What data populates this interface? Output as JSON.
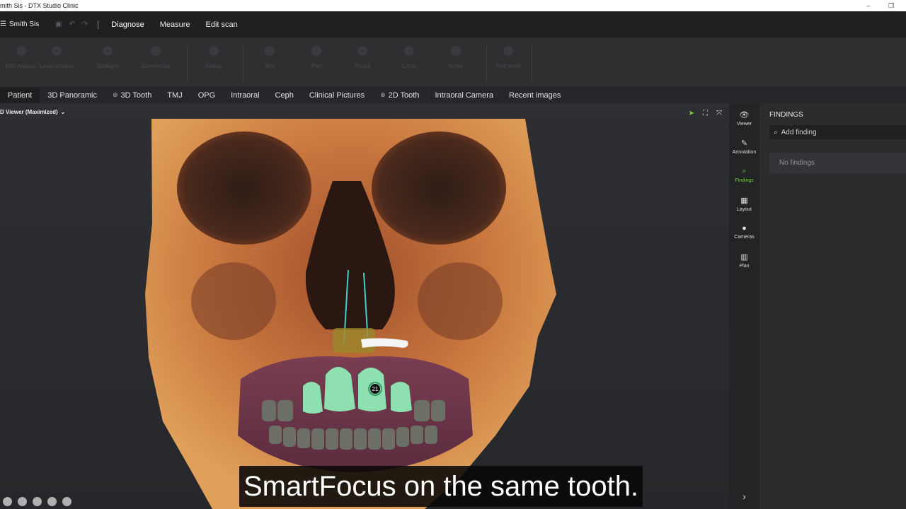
{
  "window": {
    "title": "mith Sis - DTX Studio Clinic",
    "minimize": "–",
    "restore": "❐"
  },
  "menubar": {
    "user": "Smith Sis",
    "menu": [
      "Diagnose",
      "Measure",
      "Edit scan"
    ]
  },
  "ribbon": {
    "items": [
      "Bite Appear.",
      "Level window",
      "Spotlight",
      "Screenshot",
      "Airway",
      "Text",
      "Pen",
      "Pencil",
      "Circle",
      "Arrow",
      "Find teeth"
    ]
  },
  "tabs": [
    {
      "label": "Patient",
      "icon": ""
    },
    {
      "label": "3D Panoramic",
      "icon": ""
    },
    {
      "label": "3D Tooth",
      "icon": "⊕"
    },
    {
      "label": "TMJ",
      "icon": ""
    },
    {
      "label": "OPG",
      "icon": ""
    },
    {
      "label": "Intraoral",
      "icon": ""
    },
    {
      "label": "Ceph",
      "icon": ""
    },
    {
      "label": "Clinical Pictures",
      "icon": ""
    },
    {
      "label": "2D Tooth",
      "icon": "⊕"
    },
    {
      "label": "Intraoral Camera",
      "icon": ""
    },
    {
      "label": "Recent images",
      "icon": ""
    }
  ],
  "viewer": {
    "title": "D Viewer (Maximized)",
    "tooth_number": "21",
    "subtitle": "SmartFocus on the same tooth."
  },
  "rightbar": {
    "items": [
      {
        "label": "Viewer",
        "glyph": "👁"
      },
      {
        "label": "Annotation",
        "glyph": "✎"
      },
      {
        "label": "Findings",
        "glyph": "⌕"
      },
      {
        "label": "Layout",
        "glyph": "▦"
      },
      {
        "label": "Cameras",
        "glyph": "●"
      },
      {
        "label": "Plan",
        "glyph": "▥"
      }
    ]
  },
  "findings": {
    "title": "FINDINGS",
    "search_placeholder": "Add finding",
    "empty_text": "No findings"
  },
  "colors": {
    "accent_green": "#72d045",
    "background": "#2a2b2d"
  }
}
